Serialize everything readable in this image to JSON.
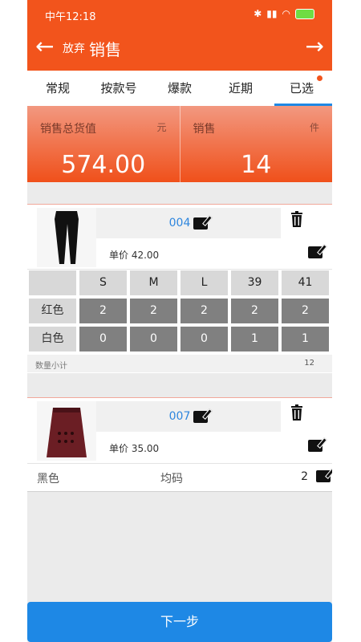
{
  "status": {
    "time": "中午12:18"
  },
  "header": {
    "abandon_label": "放弃",
    "title": "销售"
  },
  "tabs": [
    {
      "label": "常规"
    },
    {
      "label": "按款号"
    },
    {
      "label": "爆款"
    },
    {
      "label": "近期"
    },
    {
      "label": "已选"
    }
  ],
  "summary": {
    "total_label": "销售总货值",
    "total_unit": "元",
    "total_value": "574.00",
    "count_label": "销售",
    "count_unit": "件",
    "count_value": "14"
  },
  "items": [
    {
      "code": "004",
      "price": "单价 42.00",
      "sizes": [
        "S",
        "M",
        "L",
        "39",
        "41"
      ],
      "rows": [
        {
          "color": "红色",
          "qty": [
            "2",
            "2",
            "2",
            "2",
            "2"
          ]
        },
        {
          "color": "白色",
          "qty": [
            "0",
            "0",
            "0",
            "1",
            "1"
          ]
        }
      ],
      "subtotal_label": "数量小计",
      "subtotal_value": "12"
    },
    {
      "code": "007",
      "price": "单价 35.00",
      "variant": {
        "color": "黑色",
        "size": "均码",
        "qty": "2"
      }
    }
  ],
  "footer": {
    "next_label": "下一步"
  },
  "colors": {
    "primary": "#f2541c",
    "accent": "#1e88e5",
    "qty_cell": "#808080"
  }
}
